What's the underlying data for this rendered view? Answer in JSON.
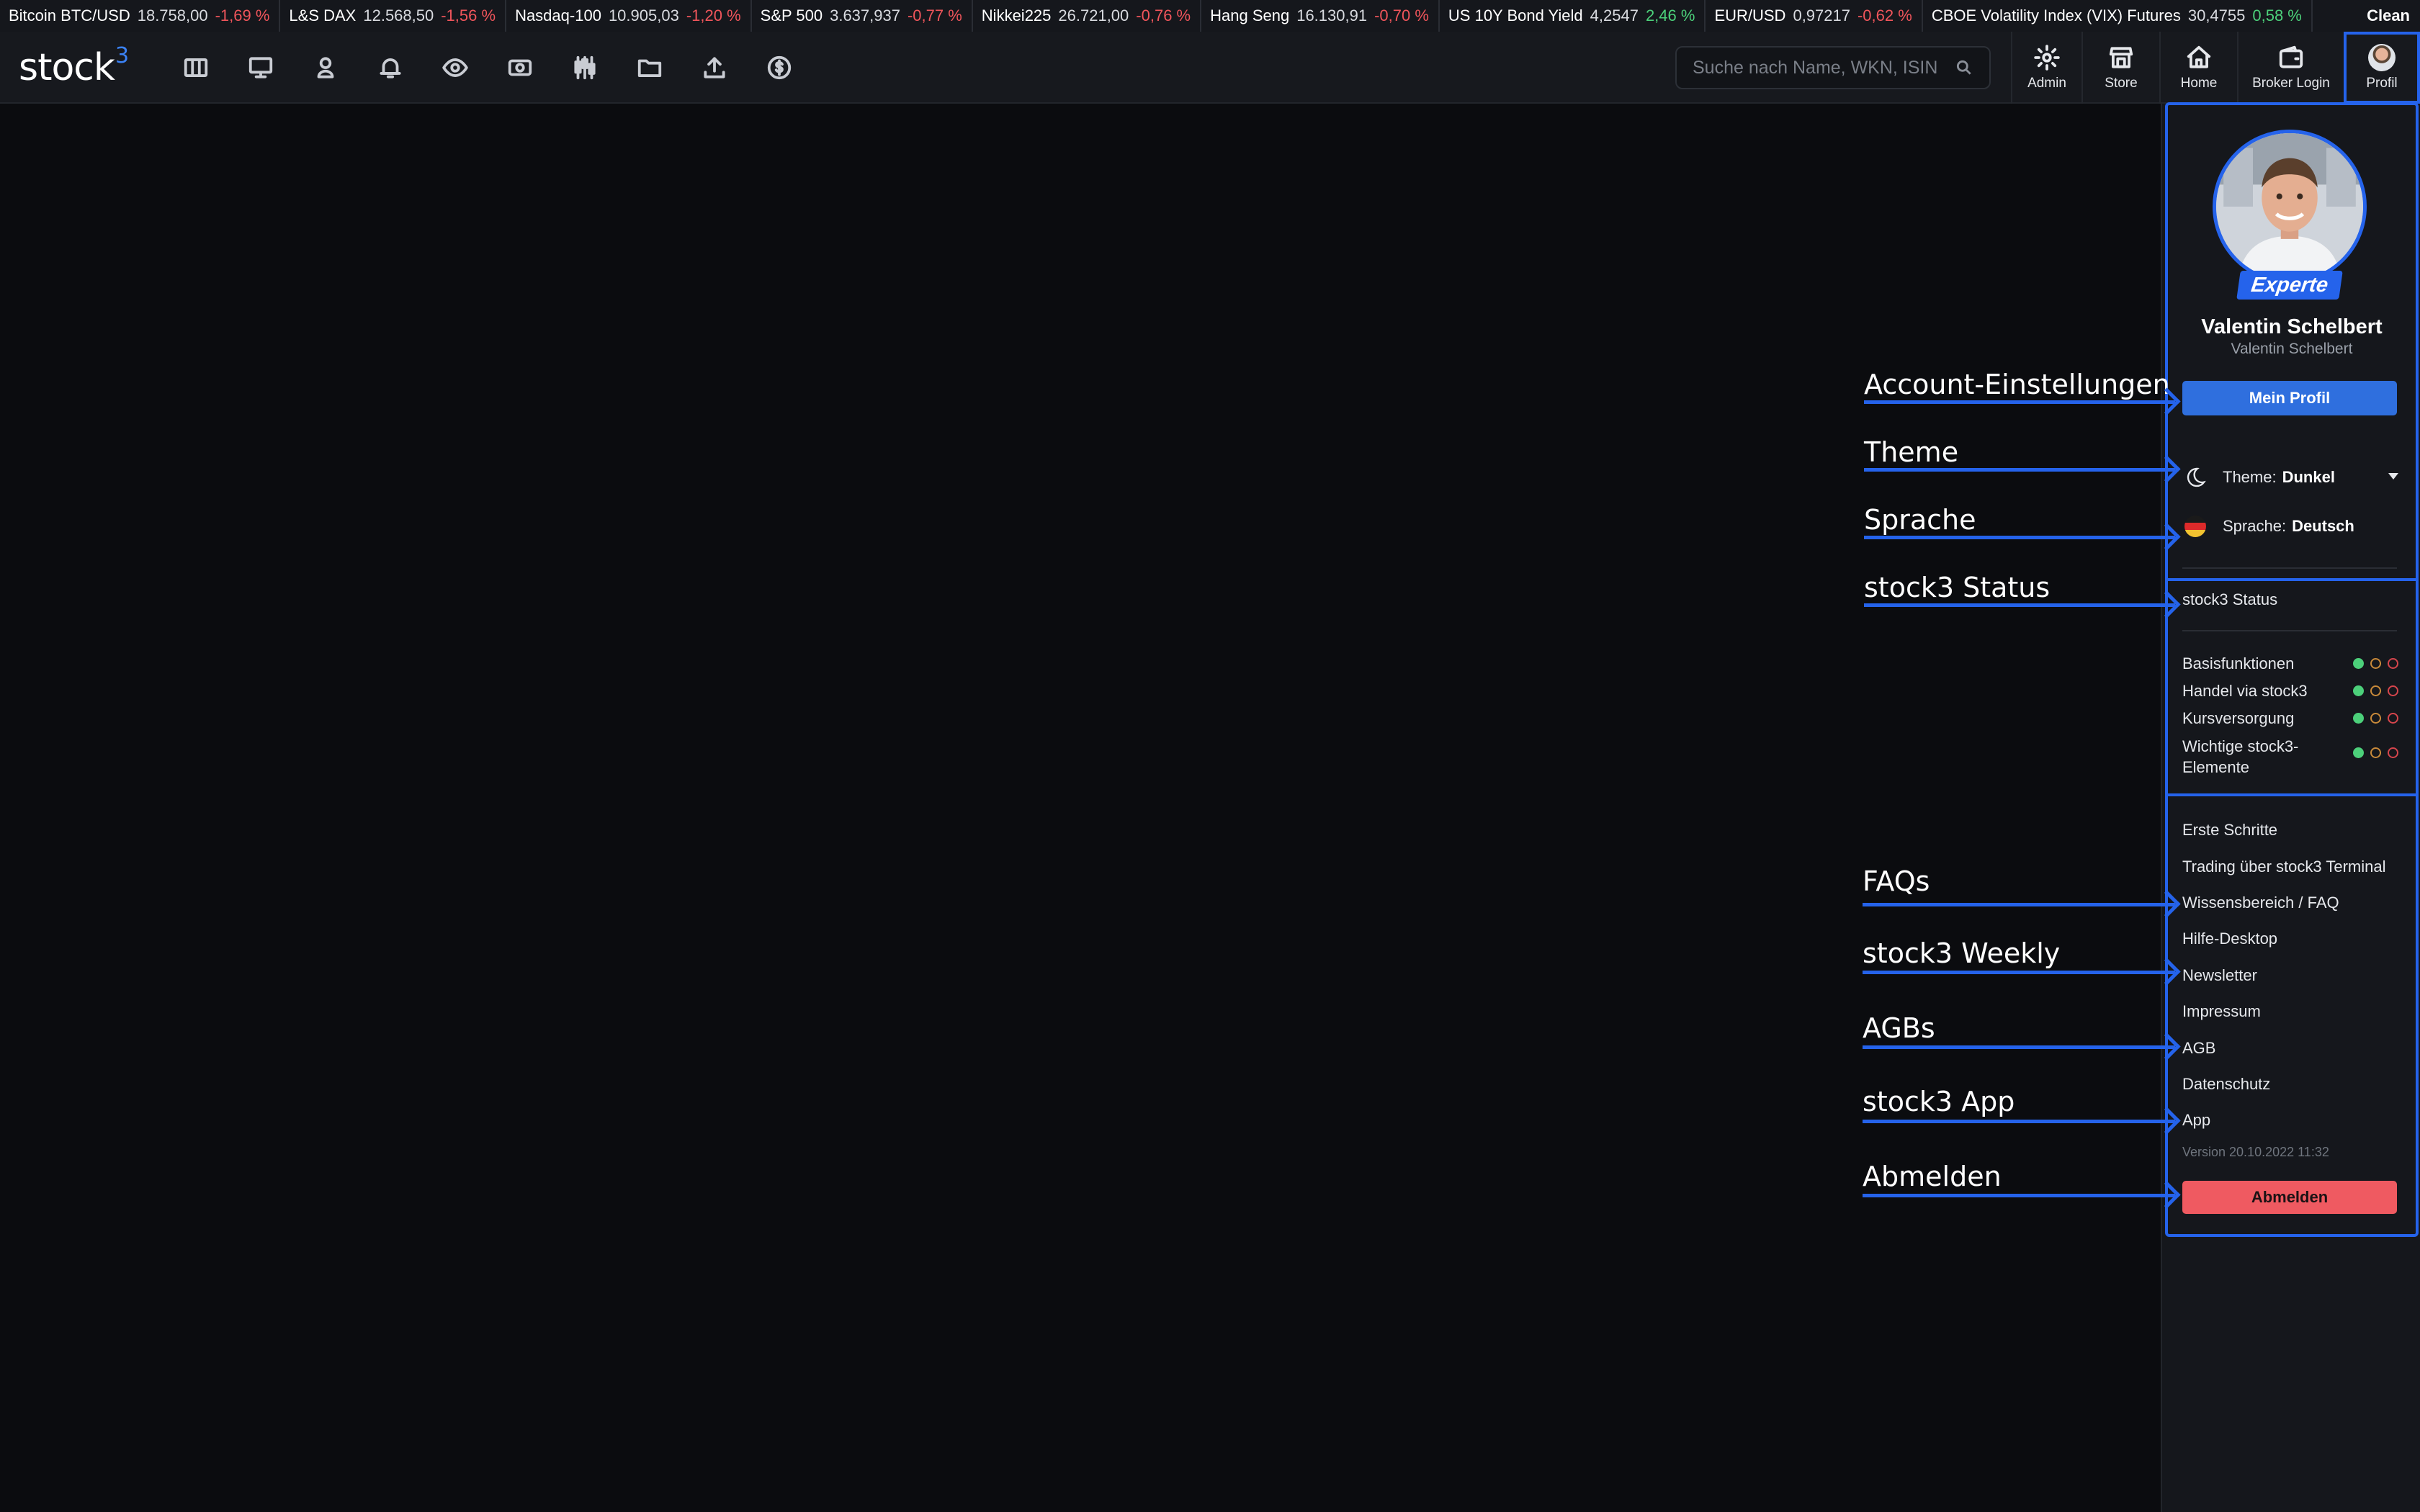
{
  "ticker": [
    {
      "name": "Bitcoin BTC/USD",
      "price": "18.758,00",
      "change": "-1,69 %",
      "dir": "neg"
    },
    {
      "name": "L&S DAX",
      "price": "12.568,50",
      "change": "-1,56 %",
      "dir": "neg"
    },
    {
      "name": "Nasdaq-100",
      "price": "10.905,03",
      "change": "-1,20 %",
      "dir": "neg"
    },
    {
      "name": "S&P 500",
      "price": "3.637,937",
      "change": "-0,77 %",
      "dir": "neg"
    },
    {
      "name": "Nikkei225",
      "price": "26.721,00",
      "change": "-0,76 %",
      "dir": "neg"
    },
    {
      "name": "Hang Seng",
      "price": "16.130,91",
      "change": "-0,70 %",
      "dir": "neg"
    },
    {
      "name": "US 10Y Bond Yield",
      "price": "4,2547",
      "change": "2,46 %",
      "dir": "pos"
    },
    {
      "name": "EUR/USD",
      "price": "0,97217",
      "change": "-0,62 %",
      "dir": "neg"
    },
    {
      "name": "CBOE Volatility Index (VIX) Futures",
      "price": "30,4755",
      "change": "0,58 %",
      "dir": "pos"
    }
  ],
  "ticker_clean": "Clean",
  "nav": {
    "logo": "stock",
    "logo_sup": "3",
    "icons": [
      "columns-icon",
      "monitor-icon",
      "user-pin-icon",
      "bell-icon",
      "eye-icon",
      "banknote-icon",
      "candlestick-icon",
      "folder-icon",
      "upload-icon",
      "dollar-coin-icon"
    ],
    "search_placeholder": "Suche nach Name, WKN, ISIN",
    "admin": "Admin",
    "store": "Store",
    "home": "Home",
    "broker_login": "Broker Login",
    "profil": "Profil"
  },
  "profile": {
    "badge": "Experte",
    "name": "Valentin Schelbert",
    "username": "Valentin Schelbert",
    "my_profile": "Mein Profil",
    "theme_label": "Theme:",
    "theme_value": "Dunkel",
    "language_label": "Sprache:",
    "language_value": "Deutsch",
    "status_title": "stock3 Status",
    "status_items": [
      "Basisfunktionen",
      "Handel via stock3",
      "Kursversorgung",
      "Wichtige stock3-Elemente"
    ],
    "links": [
      "Erste Schritte",
      "Trading über stock3 Terminal",
      "Wissensbereich / FAQ",
      "Hilfe-Desktop",
      "Newsletter",
      "Impressum",
      "AGB",
      "Datenschutz",
      "App"
    ],
    "version": "Version 20.10.2022 11:32",
    "logout": "Abmelden"
  },
  "annotations": [
    "Account-Einstellungen",
    "Theme",
    "Sprache",
    "stock3 Status",
    "FAQs",
    "stock3 Weekly",
    "AGBs",
    "stock3 App",
    "Abmelden"
  ],
  "colors": {
    "accent": "#2563eb",
    "positive": "#4cd07a",
    "negative": "#f0555b",
    "logout": "#ef5a61"
  }
}
